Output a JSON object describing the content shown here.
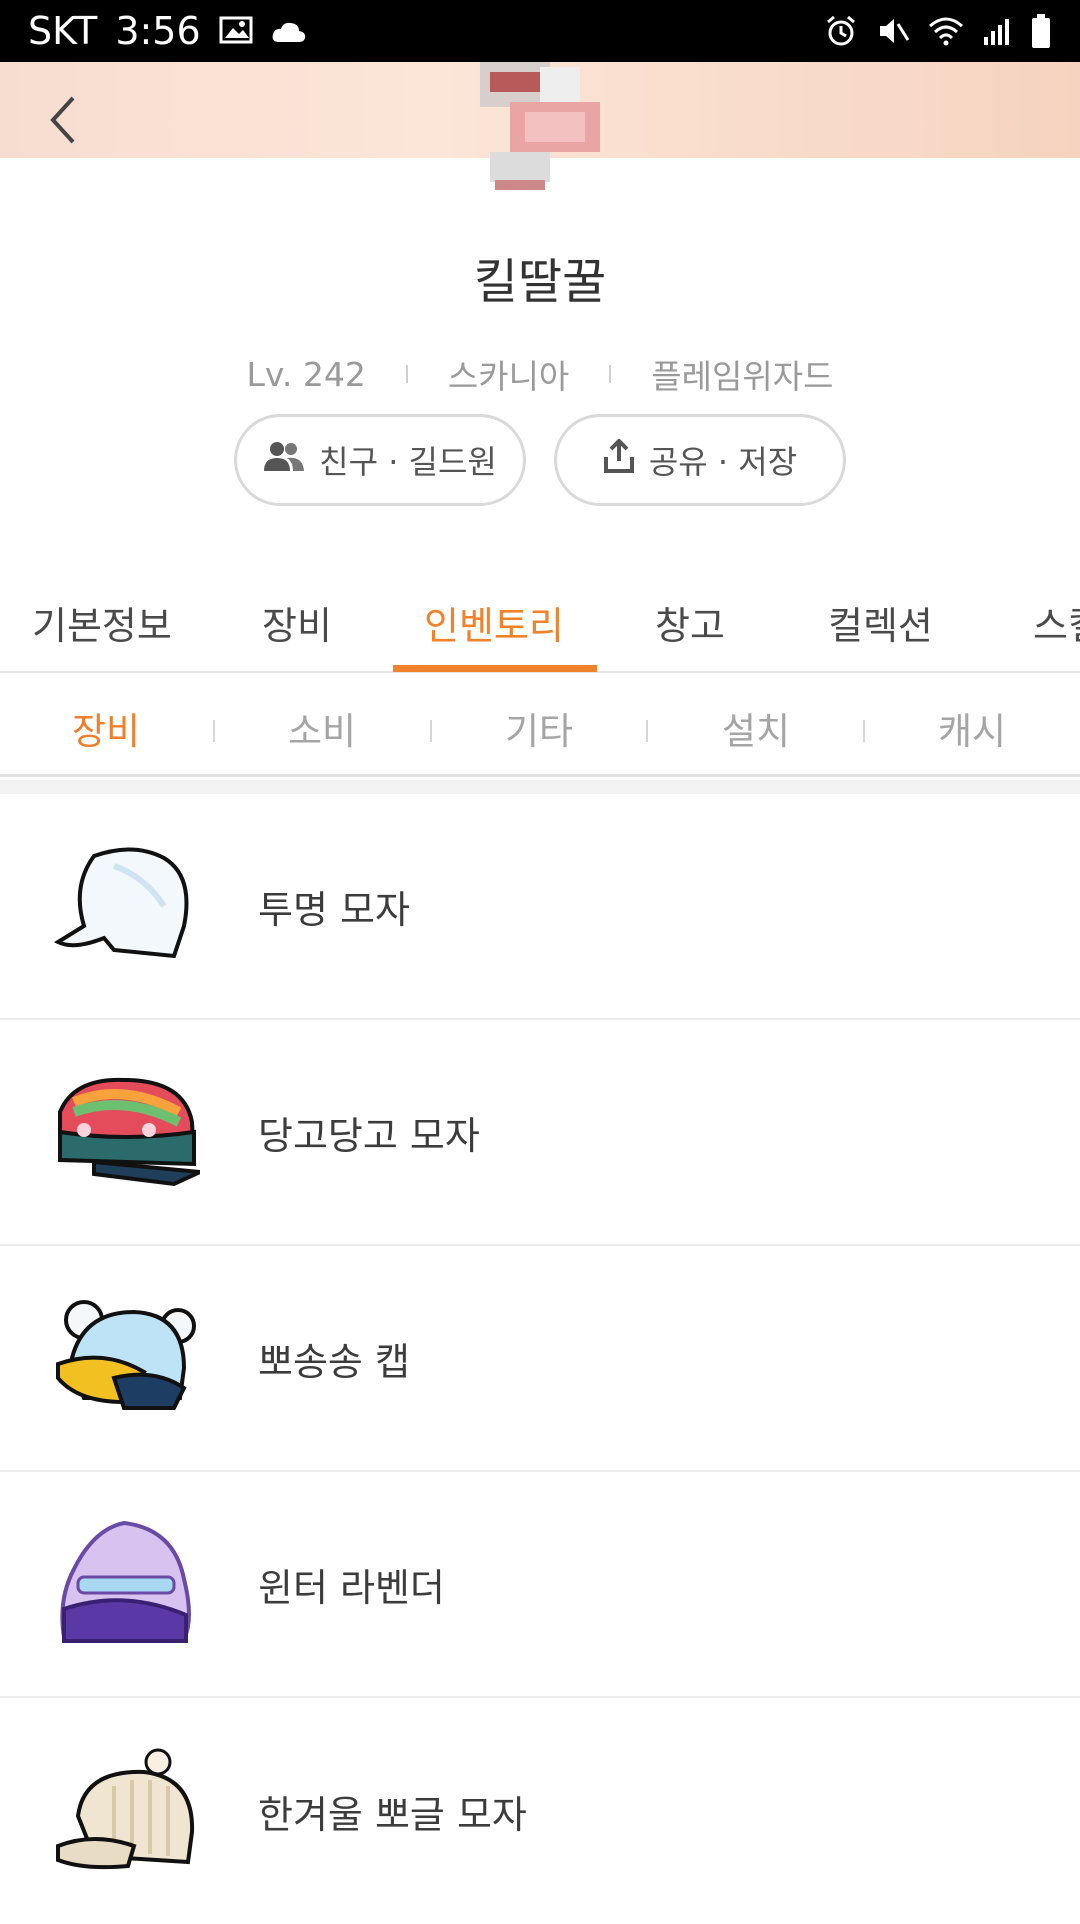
{
  "status_bar": {
    "carrier": "SKT",
    "time": "3:56"
  },
  "character": {
    "name": "킬딸꿀",
    "level": "Lv. 242",
    "world": "스카니아",
    "job": "플레임위자드"
  },
  "actions": {
    "friends_label": "친구 · 길드원",
    "share_label": "공유 · 저장"
  },
  "tabs": [
    {
      "label": "기본정보"
    },
    {
      "label": "장비"
    },
    {
      "label": "인벤토리",
      "active": true
    },
    {
      "label": "창고"
    },
    {
      "label": "컬렉션"
    },
    {
      "label": "스킬"
    }
  ],
  "subtabs": [
    {
      "label": "장비",
      "active": true
    },
    {
      "label": "소비"
    },
    {
      "label": "기타"
    },
    {
      "label": "설치"
    },
    {
      "label": "캐시"
    }
  ],
  "items": [
    {
      "name": "투명 모자",
      "icon": "transparent-hat-icon"
    },
    {
      "name": "당고당고 모자",
      "icon": "dango-hat-icon"
    },
    {
      "name": "뽀송송 캡",
      "icon": "fluffy-cap-icon"
    },
    {
      "name": "윈터 라벤더",
      "icon": "winter-lavender-hat-icon"
    },
    {
      "name": "한겨울 뽀글 모자",
      "icon": "winter-beanie-hat-icon"
    }
  ],
  "colors": {
    "accent": "#f0822b"
  }
}
